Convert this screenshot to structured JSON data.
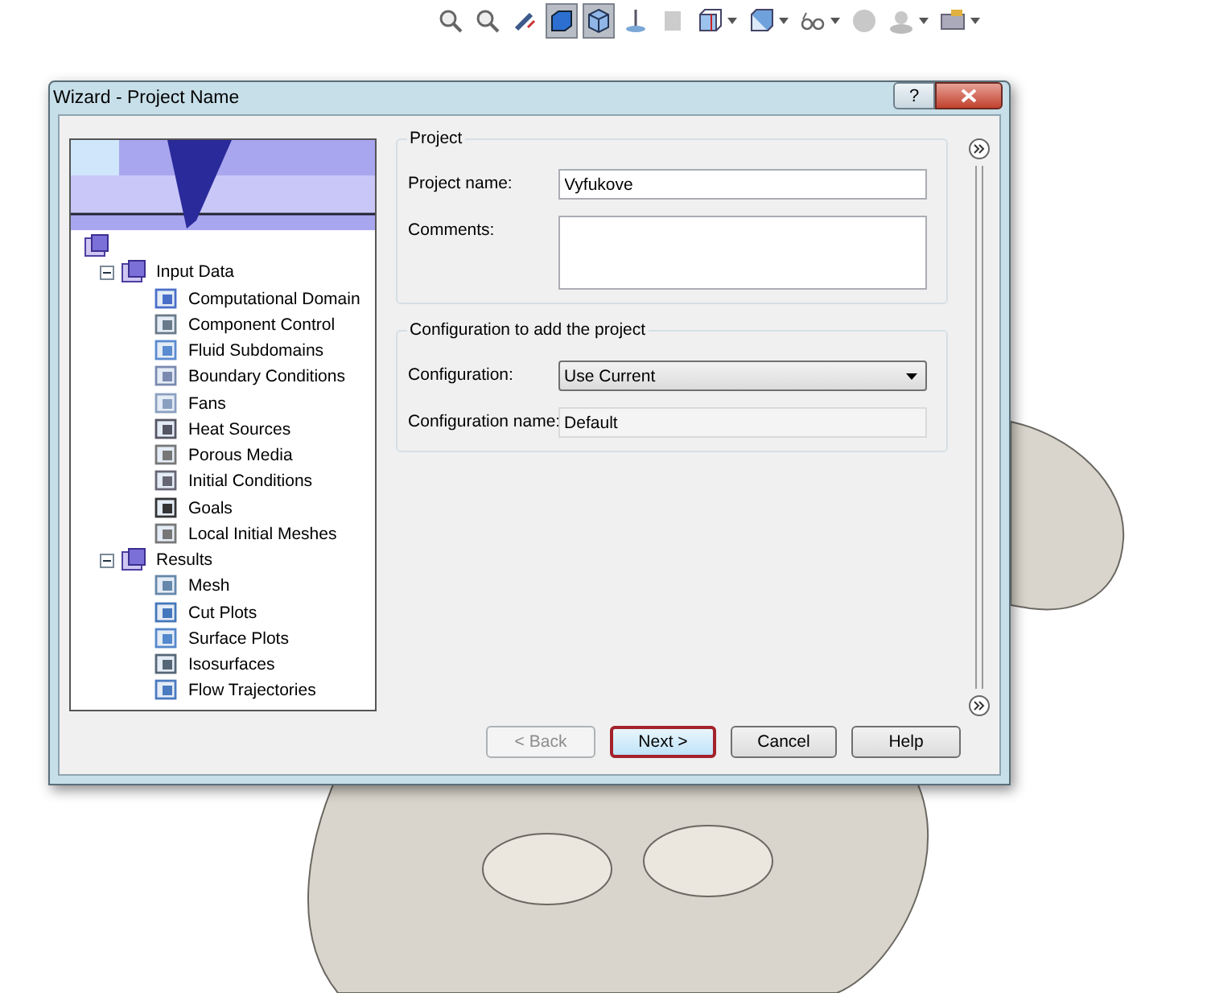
{
  "toolbar": {
    "buttons": [
      {
        "kind": "zoom-fit",
        "selected": false,
        "dropdown": false
      },
      {
        "kind": "zoom-area",
        "selected": false,
        "dropdown": false
      },
      {
        "kind": "previous-view",
        "selected": false,
        "dropdown": false
      },
      {
        "kind": "cube-shaded",
        "selected": true,
        "dropdown": false
      },
      {
        "kind": "cube-edges",
        "selected": true,
        "dropdown": false
      },
      {
        "kind": "pin",
        "selected": false,
        "dropdown": false
      },
      {
        "kind": "faded",
        "selected": false,
        "dropdown": false
      },
      {
        "kind": "section",
        "selected": false,
        "dropdown": true
      },
      {
        "kind": "cube",
        "selected": false,
        "dropdown": true
      },
      {
        "kind": "glasses",
        "selected": false,
        "dropdown": true
      },
      {
        "kind": "sphere",
        "selected": false,
        "dropdown": false
      },
      {
        "kind": "scene",
        "selected": false,
        "dropdown": true
      },
      {
        "kind": "monitor",
        "selected": false,
        "dropdown": true
      }
    ]
  },
  "window": {
    "title": "Wizard - Project Name",
    "help_button": "?"
  },
  "tree": {
    "children": [
      {
        "label": "Input Data",
        "expanded": true,
        "children": [
          {
            "label": "Computational Domain"
          },
          {
            "label": "Component Control"
          },
          {
            "label": "Fluid Subdomains"
          },
          {
            "label": "Boundary Conditions"
          },
          {
            "label": "Fans"
          },
          {
            "label": "Heat Sources"
          },
          {
            "label": "Porous Media"
          },
          {
            "label": "Initial Conditions"
          },
          {
            "label": "Goals"
          },
          {
            "label": "Local Initial Meshes"
          }
        ]
      },
      {
        "label": "Results",
        "expanded": true,
        "children": [
          {
            "label": "Mesh"
          },
          {
            "label": "Cut Plots"
          },
          {
            "label": "Surface Plots"
          },
          {
            "label": "Isosurfaces"
          },
          {
            "label": "Flow Trajectories"
          }
        ]
      }
    ]
  },
  "project_group": {
    "title": "Project",
    "name_label": "Project name:",
    "name_value": "Vyfukove",
    "comments_label": "Comments:"
  },
  "config_group": {
    "title": "Configuration to add the project",
    "configuration_label": "Configuration:",
    "configuration_value": "Use Current",
    "name_label": "Configuration name:",
    "name_value": "Default"
  },
  "buttons": [
    {
      "label": "< Back",
      "disabled": true,
      "default": false
    },
    {
      "label": "Next >",
      "disabled": false,
      "default": true
    },
    {
      "label": "Cancel",
      "disabled": false,
      "default": false
    },
    {
      "label": "Help",
      "disabled": false,
      "default": false
    }
  ]
}
